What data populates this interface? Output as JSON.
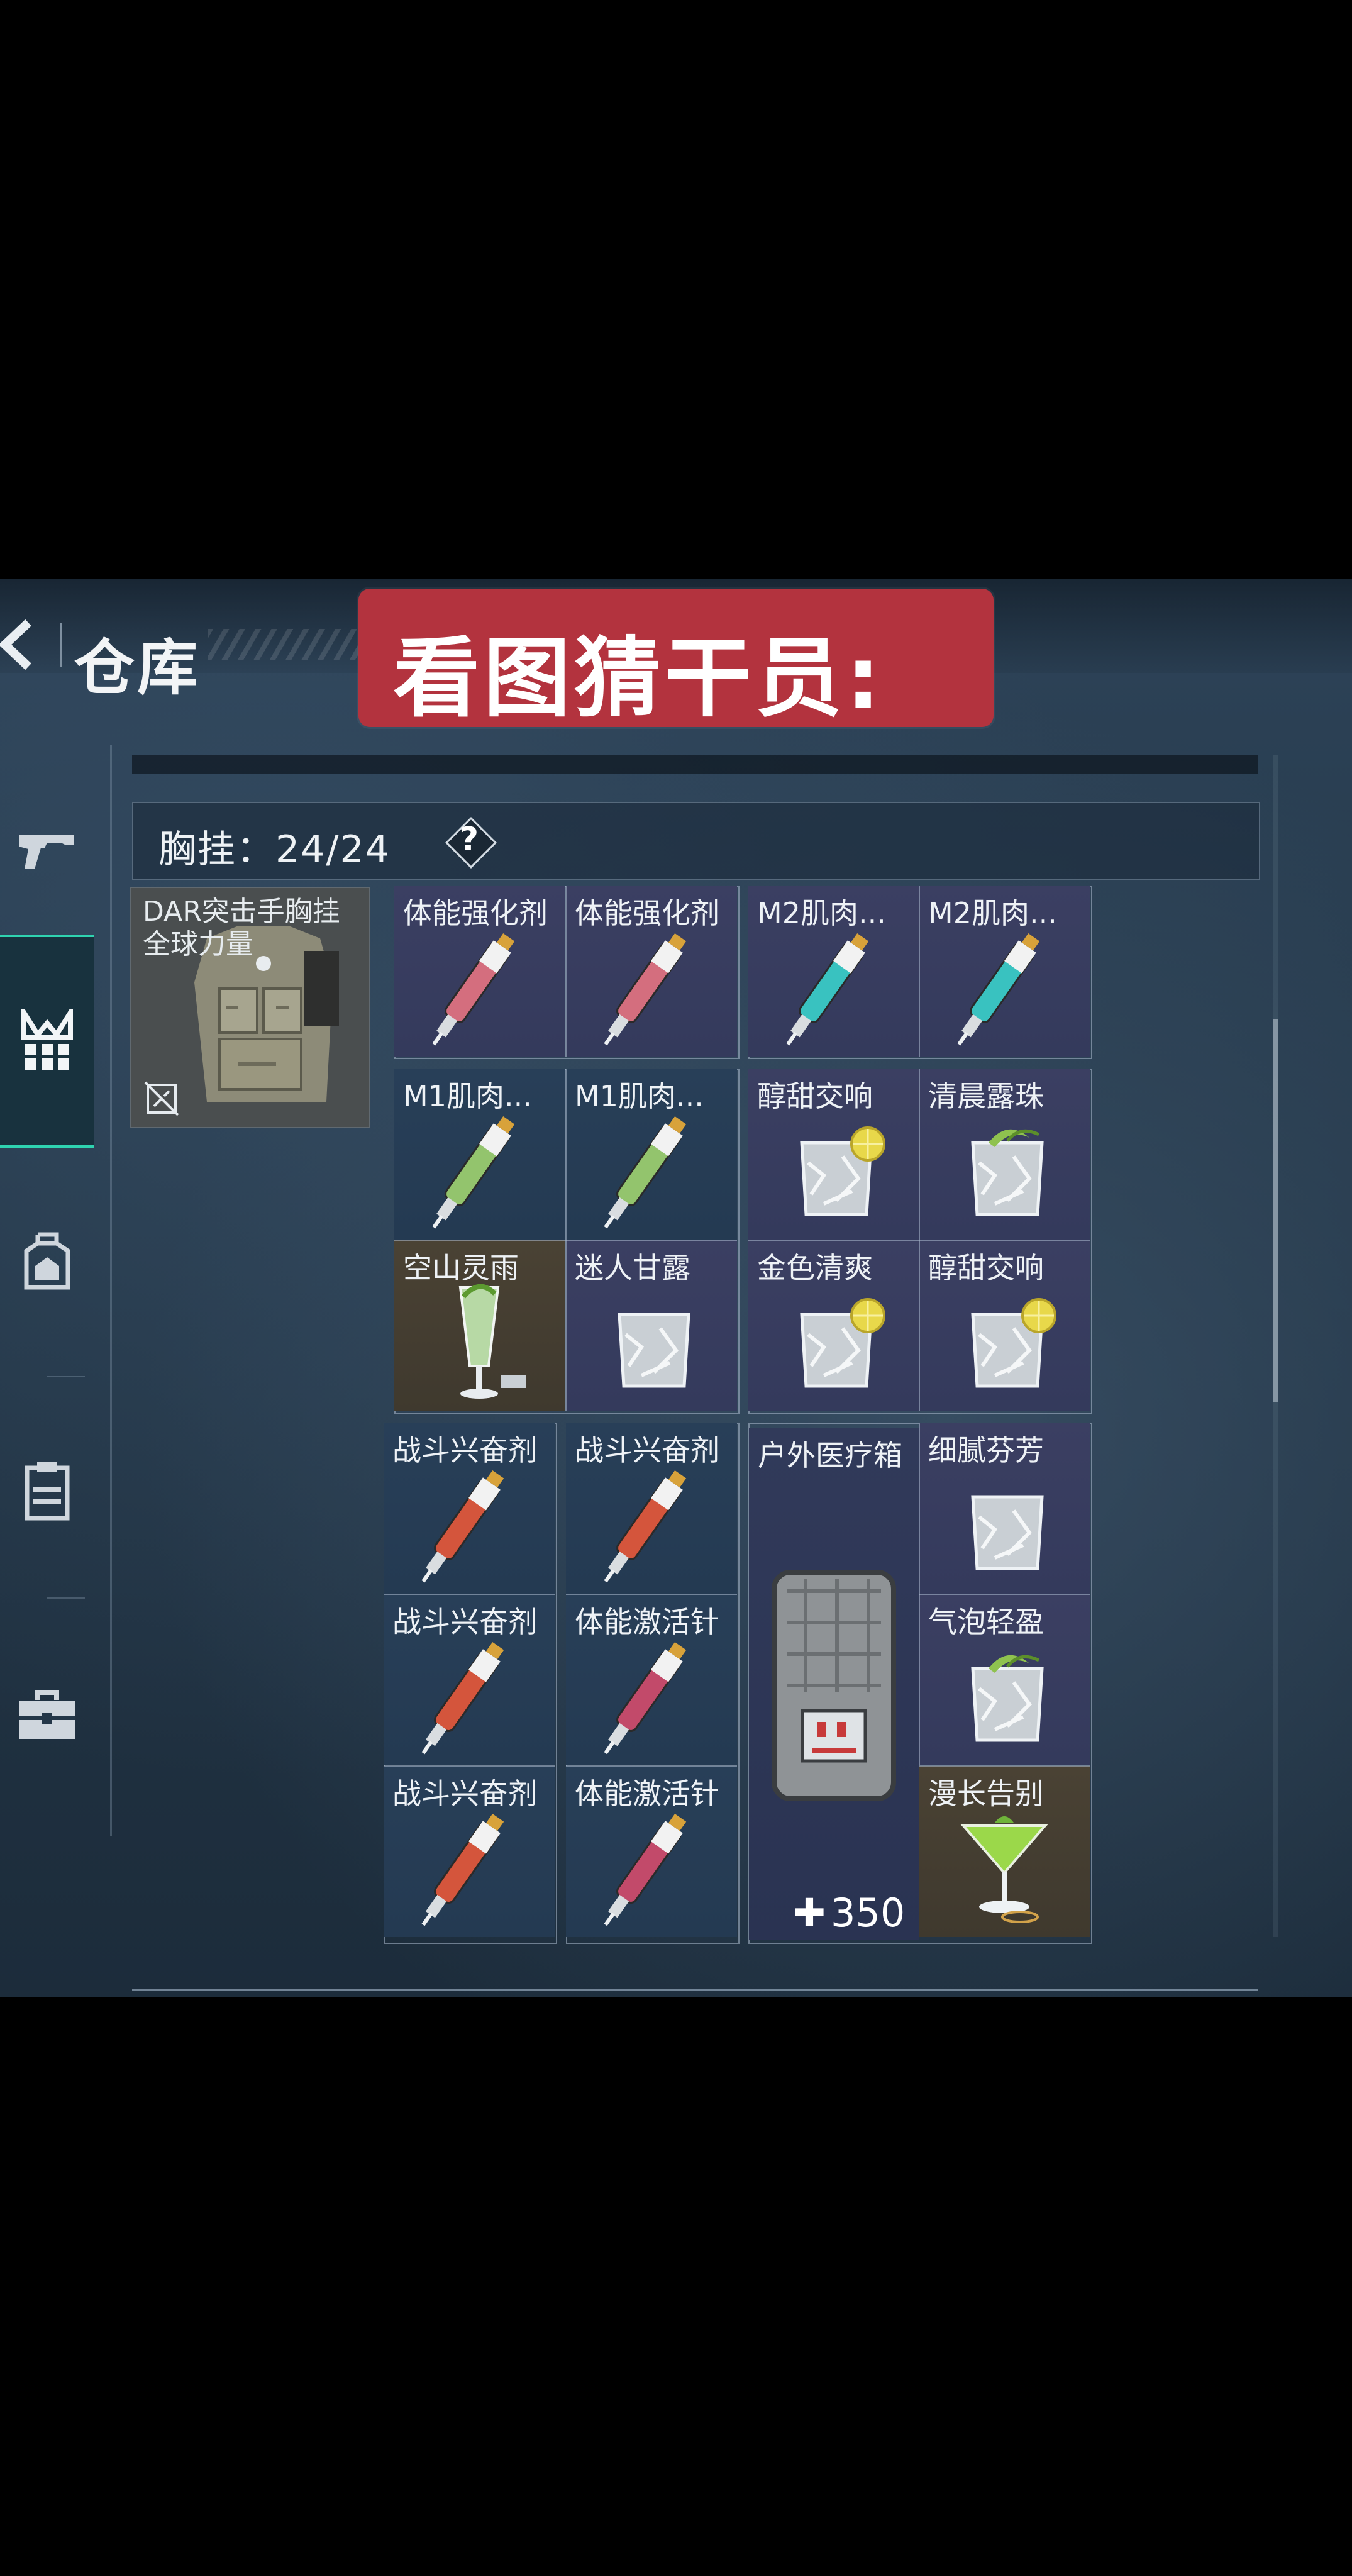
{
  "header": {
    "page_title": "仓库",
    "banner_text": "看图猜干员:"
  },
  "sidebar": {
    "items": [
      {
        "icon": "pistol-icon",
        "active": false
      },
      {
        "icon": "chest-rig-icon",
        "active": true
      },
      {
        "icon": "backpack-icon",
        "active": false
      },
      {
        "icon": "pouch-icon",
        "active": false
      },
      {
        "icon": "case-icon",
        "active": false
      }
    ]
  },
  "section": {
    "label": "胸挂：24/24",
    "help": "?"
  },
  "equipped_rig": {
    "name": "DAR突击手胸挂 全球力量"
  },
  "items": [
    {
      "label": "体能强化剂",
      "type": "syringe-pink"
    },
    {
      "label": "体能强化剂",
      "type": "syringe-pink"
    },
    {
      "label": "M2肌肉...",
      "type": "syringe-teal"
    },
    {
      "label": "M2肌肉...",
      "type": "syringe-teal"
    },
    {
      "label": "M1肌肉...",
      "type": "syringe-green"
    },
    {
      "label": "M1肌肉...",
      "type": "syringe-green"
    },
    {
      "label": "醇甜交响",
      "type": "drink-lemon"
    },
    {
      "label": "清晨露珠",
      "type": "drink-mint"
    },
    {
      "label": "空山灵雨",
      "type": "drink-tall"
    },
    {
      "label": "迷人甘露",
      "type": "drink-plain"
    },
    {
      "label": "金色清爽",
      "type": "drink-lemon"
    },
    {
      "label": "醇甜交响",
      "type": "drink-lemon"
    },
    {
      "label": "战斗兴奋剂",
      "type": "syringe-red"
    },
    {
      "label": "战斗兴奋剂",
      "type": "syringe-red"
    },
    {
      "label": "户外医疗箱",
      "type": "medkit"
    },
    {
      "label": "细腻芬芳",
      "type": "drink-plain"
    },
    {
      "label": "战斗兴奋剂",
      "type": "syringe-red"
    },
    {
      "label": "体能激活针",
      "type": "syringe-magenta"
    },
    {
      "label": "气泡轻盈",
      "type": "drink-mint"
    },
    {
      "label": "战斗兴奋剂",
      "type": "syringe-red"
    },
    {
      "label": "体能激活针",
      "type": "syringe-magenta"
    },
    {
      "label": "漫长告别",
      "type": "drink-martini"
    }
  ],
  "medkit": {
    "heal_value": "350"
  },
  "colors": {
    "banner": "#b3333e",
    "active_accent": "#2fd3b0",
    "cell_blue": "#273e57",
    "cell_purple": "#383d60",
    "cell_gold": "#463f32"
  }
}
